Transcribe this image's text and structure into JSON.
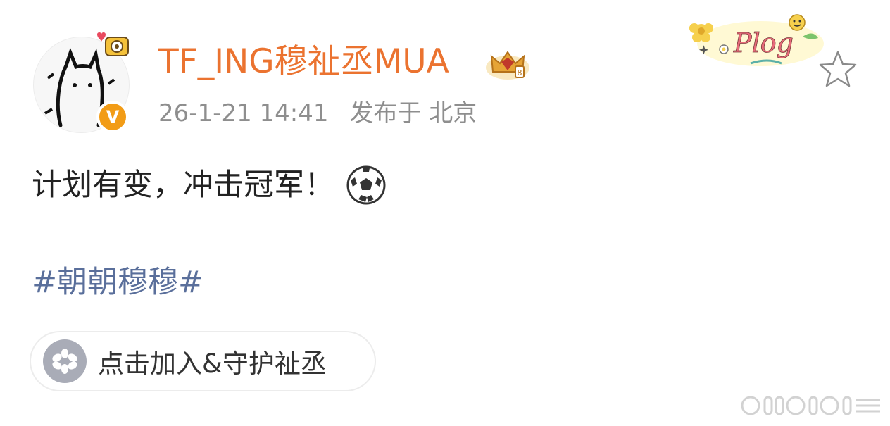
{
  "post": {
    "username": "TF_ING穆祉丞MUA",
    "timestamp": "26-1-21 14:41",
    "location": "发布于 北京",
    "content": "计划有变，冲击冠军！",
    "topic": "#朝朝穆穆#",
    "join_label": "点击加入&守护祉丞",
    "verified_badge": "V"
  },
  "icons": {
    "avatar": "cartoon-cat-avatar",
    "badge": "verified-v-icon",
    "crown": "crown-level-icon",
    "decoration": "plog-sticker",
    "favorite": "star-icon",
    "emoji": "soccer-ball-icon",
    "join": "flower-icon"
  },
  "colors": {
    "username": "#eb7330",
    "meta": "#8e8e8e",
    "topic": "#5a6f9b",
    "badge": "#f29c16"
  }
}
